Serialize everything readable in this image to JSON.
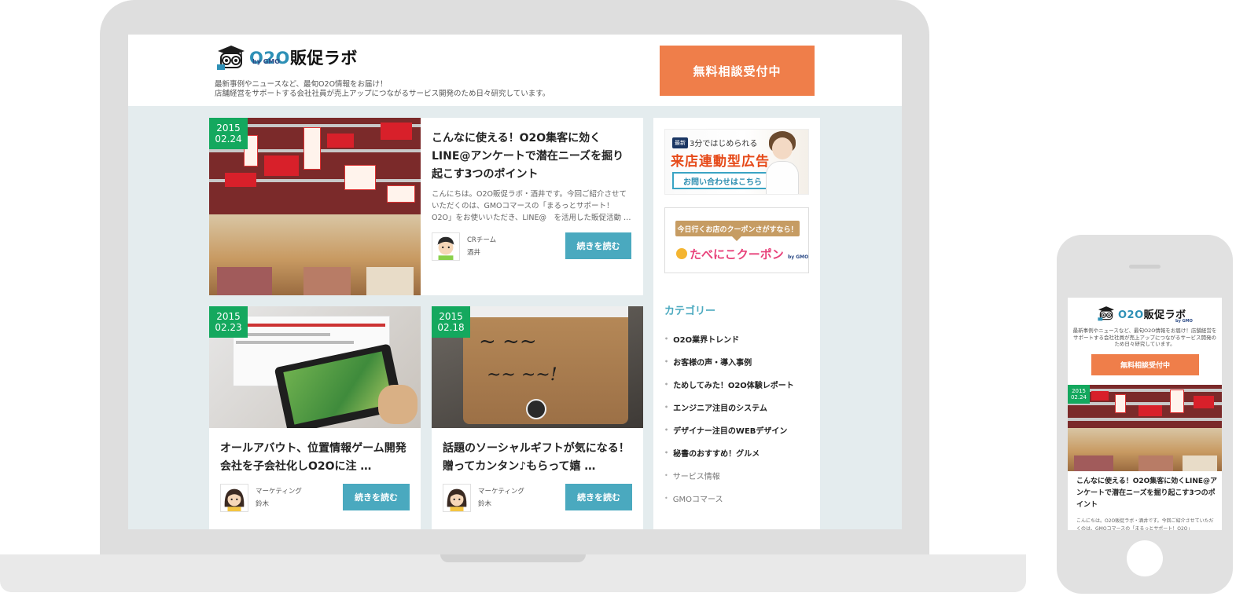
{
  "brand": {
    "name_prefix": "O2O",
    "name_suffix": "販促ラボ",
    "by": "by GMO"
  },
  "header": {
    "tagline_line1": "最新事例やニュースなど、最旬O2O情報をお届け！",
    "tagline_line2": "店舗経営をサポートする会社社員が売上アップにつながるサービス開発のため日々研究しています。",
    "cta_label": "無料相談受付中"
  },
  "articles": [
    {
      "year": "2015",
      "date": "02.24",
      "title": "こんなに使える！O2O集客に効くLINE@アンケートで潜在ニーズを掘り起こす3つのポイント",
      "excerpt": "こんにちは。O2O販促ラボ・酒井です。今回ご紹介させていただくのは、GMOコマースの「まるっとサポート！O2O」をお使いいただき、LINE@　を活用した販促活動 …",
      "author_team": "CRチーム",
      "author_name": "酒井",
      "read_more": "続きを読む"
    },
    {
      "year": "2015",
      "date": "02.23",
      "title": "オールアバウト、位置情報ゲーム開発会社を子会社化しO2Oに注 …",
      "author_team": "マーケティング",
      "author_name": "鈴木",
      "read_more": "続きを読む"
    },
    {
      "year": "2015",
      "date": "02.18",
      "title": "話題のソーシャルギフトが気になる！贈ってカンタン♪もらって嬉 …",
      "author_team": "マーケティング",
      "author_name": "鈴木",
      "read_more": "続きを読む"
    }
  ],
  "sidebar": {
    "banner1": {
      "badge": "最新",
      "small": "3分ではじめられる",
      "big": "来店連動型広告",
      "cta": "お問い合わせはこちら"
    },
    "banner2": {
      "bubble": "今日行くお店のクーポンさがすなら！",
      "brand": "たべにこクーポン",
      "brand_by": "by GMO"
    },
    "category_title": "カテゴリー",
    "categories": [
      "O2O業界トレンド",
      "お客様の声・導入事例",
      "ためしてみた！O2O体験レポート",
      "エンジニア注目のシステム",
      "デザイナー注目のWEBデザイン",
      "秘書のおすすめ！グルメ",
      "サービス情報",
      "GMOコマース"
    ]
  },
  "mobile": {
    "tagline": "最新事例やニュースなど、最旬O2O情報をお届け！店舗経営をサポートする会社社員が売上アップにつながるサービス開発のため日々研究しています。",
    "cta_label": "無料相談受付中",
    "year": "2015",
    "date": "02.24",
    "title": "こんなに使える！O2O集客に効くLINE@アンケートで潜在ニーズを掘り起こす3つのポイント",
    "excerpt": "こんにちは。O2O販促ラボ・酒井です。今回ご紹介させていただくのは、GMOコマースの「まるっとサポート！O2O」"
  },
  "colors": {
    "accent_orange": "#ef7e4a",
    "accent_teal": "#4aa9bf",
    "date_green": "#14a85e",
    "logo_blue": "#2e90b6"
  }
}
